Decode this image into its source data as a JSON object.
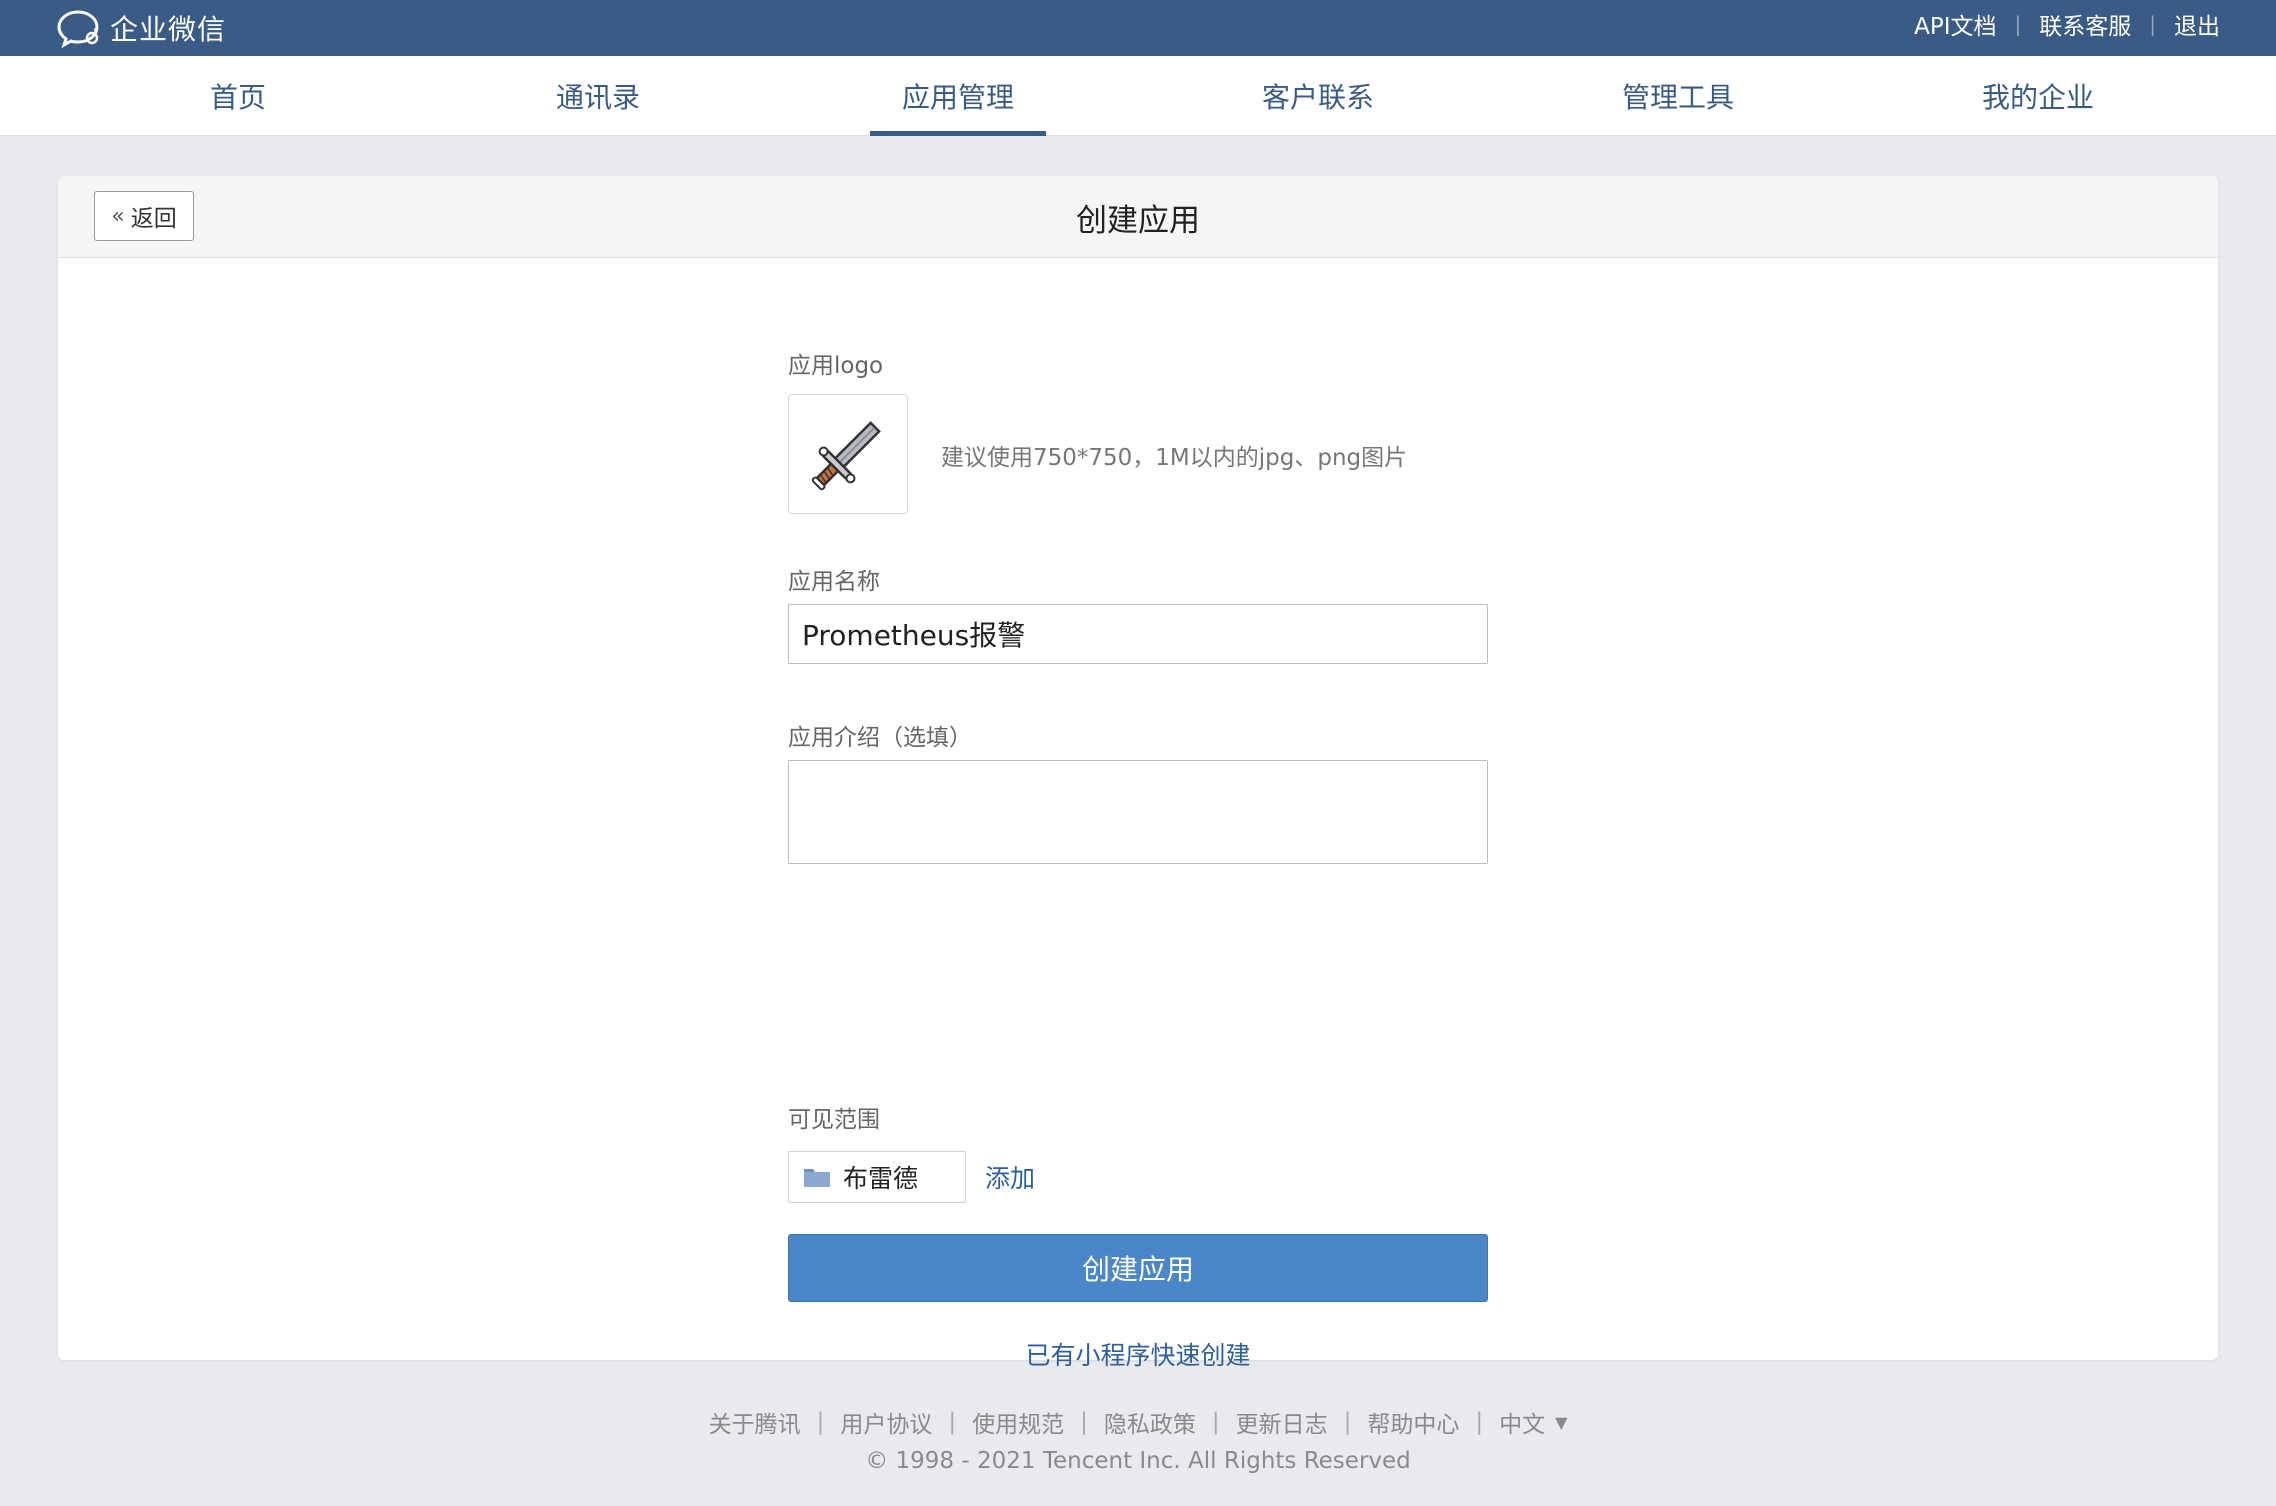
{
  "brand": {
    "name": "企业微信"
  },
  "top_links": [
    "API文档",
    "联系客服",
    "退出"
  ],
  "nav": {
    "items": [
      "首页",
      "通讯录",
      "应用管理",
      "客户联系",
      "管理工具",
      "我的企业"
    ],
    "active": "应用管理"
  },
  "page": {
    "back_label": "返回",
    "title": "创建应用"
  },
  "form": {
    "logo_label": "应用logo",
    "logo_hint": "建议使用750*750，1M以内的jpg、png图片",
    "name_label": "应用名称",
    "name_value": "Prometheus报警",
    "intro_label": "应用介绍（选填）",
    "intro_value": "",
    "scope_label": "可见范围",
    "scope_tag": "布雷德",
    "add_label": "添加",
    "submit_label": "创建应用",
    "mini_program_link": "已有小程序快速创建"
  },
  "footer": {
    "links": [
      "关于腾讯",
      "用户协议",
      "使用规范",
      "隐私政策",
      "更新日志",
      "帮助中心"
    ],
    "language": "中文",
    "copyright": "© 1998 - 2021 Tencent Inc. All Rights Reserved"
  },
  "colors": {
    "topbar": "#3a5b85",
    "accent_link": "#2d5f9e",
    "primary_button": "#4a86c8"
  },
  "icons": {
    "brand": "wecom-chat-bubble-icon",
    "back": "double-chevron-left-icon",
    "logo": "sword-icon",
    "scope": "folder-icon",
    "language": "caret-down-icon"
  }
}
